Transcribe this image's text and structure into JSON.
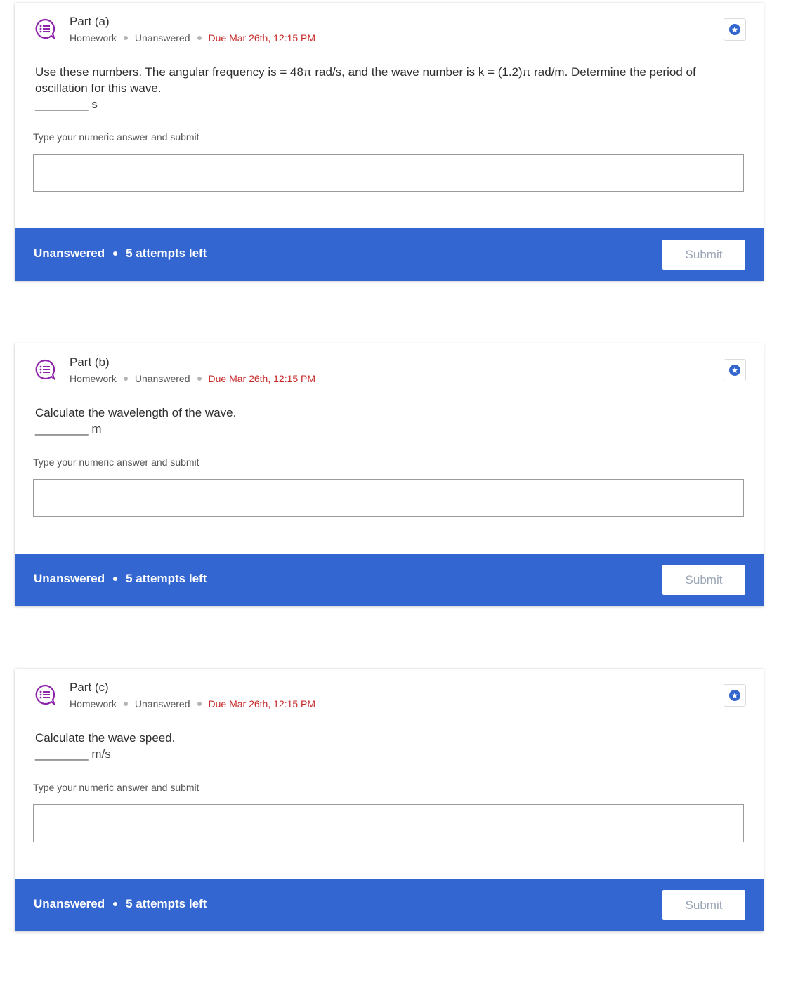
{
  "parts": [
    {
      "title": "Part (a)",
      "type": "Homework",
      "state": "Unanswered",
      "due": "Due Mar 26th, 12:15 PM",
      "question_line1": "Use these numbers. The angular frequency is = 48π rad/s, and the wave number is k = (1.2)π rad/m. Determine the period of",
      "question_line2": "oscillation for this wave.",
      "blank": "________ s",
      "hint": "Type your numeric answer and submit",
      "input_value": "",
      "footer_status": "Unanswered",
      "attempts": "5 attempts left",
      "submit_label": "Submit"
    },
    {
      "title": "Part (b)",
      "type": "Homework",
      "state": "Unanswered",
      "due": "Due Mar 26th, 12:15 PM",
      "question_line1": "Calculate the wavelength of the wave.",
      "question_line2": "",
      "blank": "________ m",
      "hint": "Type your numeric answer and submit",
      "input_value": "",
      "footer_status": "Unanswered",
      "attempts": "5 attempts left",
      "submit_label": "Submit"
    },
    {
      "title": "Part (c)",
      "type": "Homework",
      "state": "Unanswered",
      "due": "Due Mar 26th, 12:15 PM",
      "question_line1": "Calculate the wave speed.",
      "question_line2": "",
      "blank": "________ m/s",
      "hint": "Type your numeric answer and submit",
      "input_value": "",
      "footer_status": "Unanswered",
      "attempts": "5 attempts left",
      "submit_label": "Submit"
    }
  ],
  "icons": {
    "question": "question-list-icon",
    "bookmark": "star-bookmark-icon"
  },
  "colors": {
    "accent": "#3366d1",
    "due": "#c62828",
    "question_icon": "#8e24aa"
  }
}
